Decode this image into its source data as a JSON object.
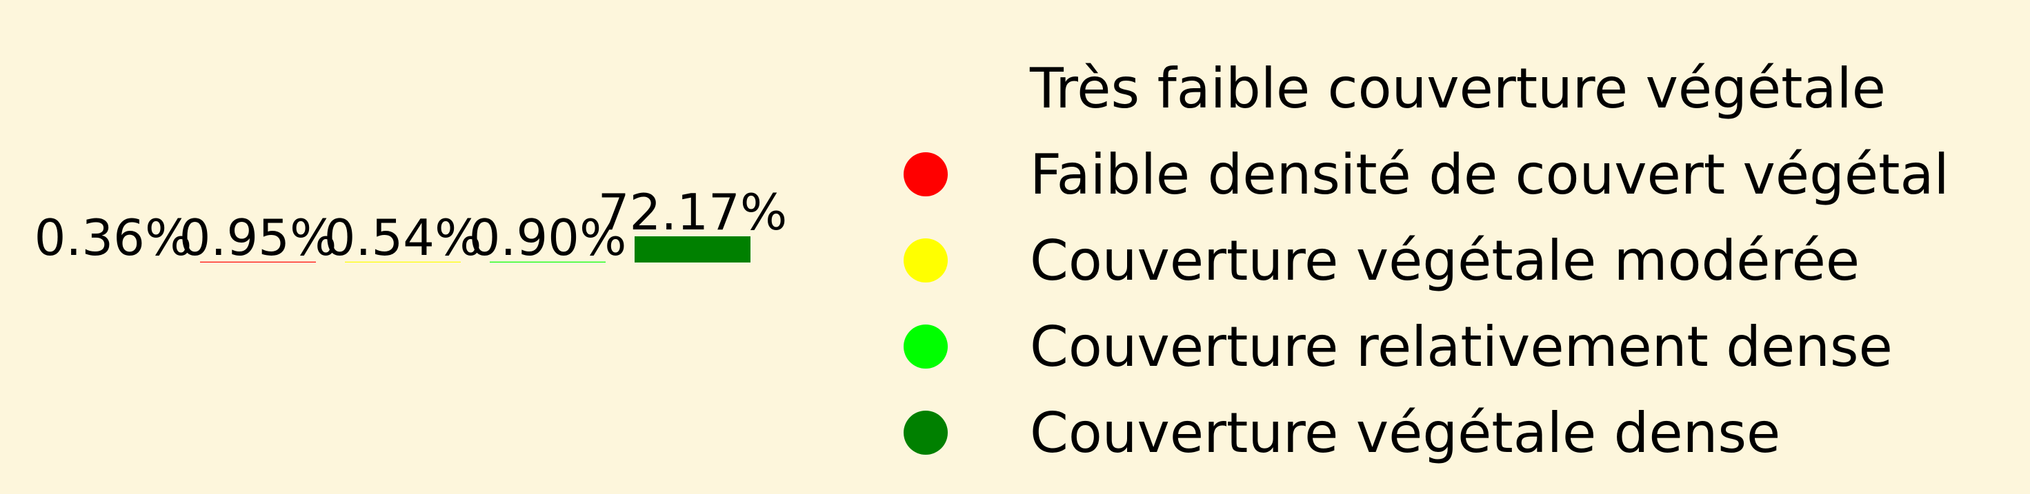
{
  "chart_data": {
    "type": "bar",
    "categories": [
      "Très faible couverture végétale",
      "Faible densité de couvert végétal",
      "Couverture végétale modérée",
      "Couverture relativement dense",
      "Couverture végétale dense"
    ],
    "values": [
      0.36,
      0.95,
      0.54,
      0.9,
      72.17
    ],
    "data_labels": [
      "0.36%",
      "0.95%",
      "0.54%",
      "0.90%",
      "72.17%"
    ],
    "colors": [
      "#fdf6dc",
      "#ff0000",
      "#ffff00",
      "#00ff00",
      "#008000"
    ],
    "grid": false,
    "legend": {
      "placement": "right",
      "entries": [
        {
          "label": "Très faible couverture végétale",
          "color": "#fdf6dc",
          "marker": "circle"
        },
        {
          "label": "Faible densité de couvert végétal",
          "color": "#ff0000",
          "marker": "circle"
        },
        {
          "label": "Couverture végétale modérée",
          "color": "#ffff00",
          "marker": "circle"
        },
        {
          "label": "Couverture relativement dense",
          "color": "#00ff00",
          "marker": "circle"
        },
        {
          "label": "Couverture végétale dense",
          "color": "#008000",
          "marker": "circle"
        }
      ]
    }
  }
}
